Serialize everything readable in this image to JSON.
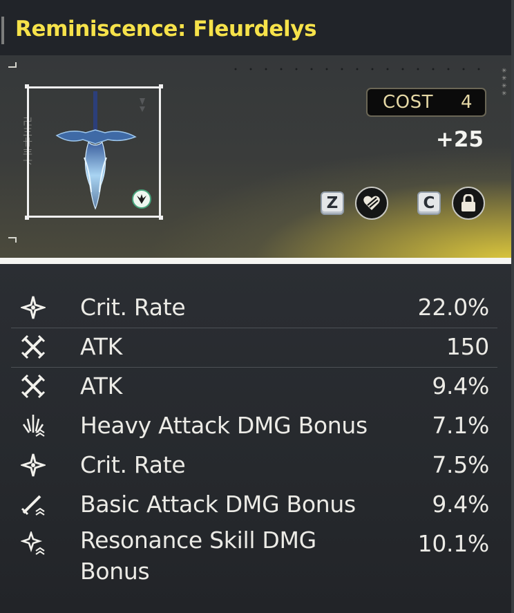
{
  "header": {
    "title": "Reminiscence: Fleurdelys"
  },
  "item": {
    "cost_label": "COST",
    "cost_value": "4",
    "level": "+25",
    "hotkeys": {
      "discard_key": "Z",
      "lock_key": "C"
    },
    "icons": {
      "discard": "heart-broken-icon",
      "lock": "lock-icon",
      "sonata": "sonata-emblem-icon"
    }
  },
  "colors": {
    "title": "#f6e24a",
    "accent_glow": "#e6d03c",
    "text": "#ecebe6"
  },
  "stats": [
    {
      "icon": "crit-star-icon",
      "name": "Crit. Rate",
      "value": "22.0%"
    },
    {
      "icon": "crossed-swords-icon",
      "name": "ATK",
      "value": "150"
    },
    {
      "icon": "crossed-swords-icon",
      "name": "ATK",
      "value": "9.4%"
    },
    {
      "icon": "heavy-attack-icon",
      "name": "Heavy Attack DMG Bonus",
      "value": "7.1%"
    },
    {
      "icon": "crit-star-icon",
      "name": "Crit. Rate",
      "value": "7.5%"
    },
    {
      "icon": "basic-attack-icon",
      "name": "Basic Attack DMG Bonus",
      "value": "9.4%"
    },
    {
      "icon": "resonance-skill-icon",
      "name": "Resonance Skill DMG Bonus",
      "value": "10.1%"
    }
  ]
}
